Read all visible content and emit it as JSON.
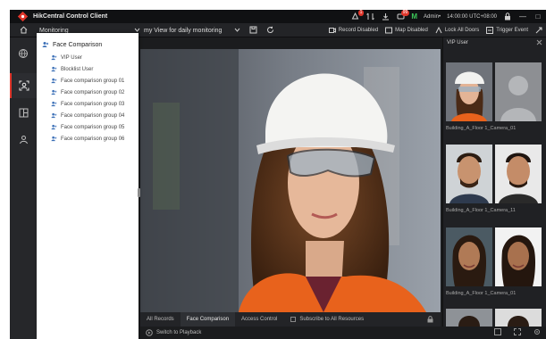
{
  "app": {
    "title": "HikCentral Control Client"
  },
  "titlebar": {
    "alarm_badge": "1",
    "msg_badge": "99",
    "m_label": "M",
    "user": "Admin•",
    "time": "14:00:00 UTC+08:00",
    "win_min": "—",
    "win_max": "□"
  },
  "toolbar": {
    "module": "Monitoring",
    "view": "my View for daily monitoring",
    "record_disabled": "Record Disabled",
    "map_disabled": "Map Disabled",
    "lock_all_doors": "Lock All Doors",
    "trigger_event": "Trigger Event"
  },
  "tree": {
    "root": "Face Comparison",
    "items": [
      {
        "label": "VIP User"
      },
      {
        "label": "Blocklist User"
      },
      {
        "label": "Face comparison group 01"
      },
      {
        "label": "Face comparison group 02"
      },
      {
        "label": "Face comparison group 03"
      },
      {
        "label": "Face comparison group 04"
      },
      {
        "label": "Face comparison group 05"
      },
      {
        "label": "Face comparison group 06"
      }
    ]
  },
  "bottom_tabs": {
    "all_records": "All Records",
    "face_comparison": "Face Comparison",
    "access_control": "Access Control",
    "subscribe": "Subscribe to All Resources"
  },
  "status": {
    "playback": "Switch to Playback"
  },
  "right_panel": {
    "title": "VIP User",
    "groups": [
      {
        "caption": "Building_A_Floor 1_Camera_01"
      },
      {
        "caption": "Building_A_Floor 1_Camera_11"
      },
      {
        "caption": "Building_A_Floor 1_Camera_01"
      }
    ]
  },
  "colors": {
    "accent": "#e0362b",
    "online": "#3cc85a",
    "panel": "#1b1c1e",
    "tree_bg": "#ffffff"
  }
}
